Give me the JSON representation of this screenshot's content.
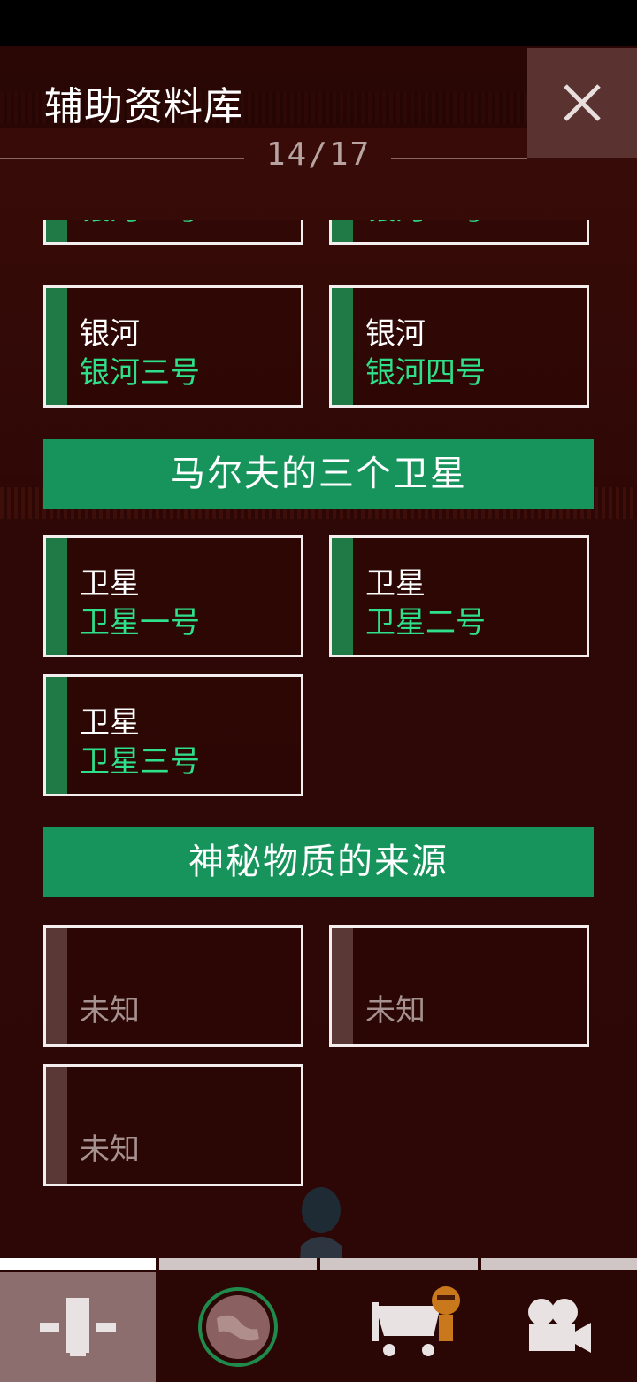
{
  "header": {
    "title": "辅助资料库",
    "page_counter": "14/17",
    "close_icon": "close-icon"
  },
  "partial_cards": [
    {
      "subtitle": "银河一号"
    },
    {
      "subtitle": "银河二号"
    }
  ],
  "galaxy_cards": [
    {
      "title": "银河",
      "subtitle": "银河三号"
    },
    {
      "title": "银河",
      "subtitle": "银河四号"
    }
  ],
  "sections": [
    {
      "title": "马尔夫的三个卫星",
      "cards": [
        {
          "title": "卫星",
          "subtitle": "卫星一号"
        },
        {
          "title": "卫星",
          "subtitle": "卫星二号"
        },
        {
          "title": "卫星",
          "subtitle": "卫星三号"
        }
      ]
    },
    {
      "title": "神秘物质的来源",
      "cards": [
        {
          "status": "未知"
        },
        {
          "status": "未知"
        },
        {
          "status": "未知"
        }
      ]
    }
  ],
  "tabs": [
    {
      "icon": "database-icon",
      "active": true
    },
    {
      "icon": "planet-icon",
      "active": false
    },
    {
      "icon": "cart-icon",
      "active": false
    },
    {
      "icon": "camera-icon",
      "active": false
    }
  ],
  "colors": {
    "accent_green": "#16945c",
    "text_green": "#2ee08a",
    "background": "#2a0604"
  }
}
